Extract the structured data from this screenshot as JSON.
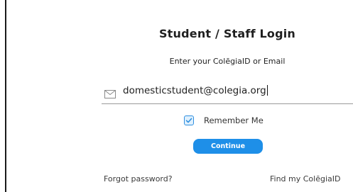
{
  "login": {
    "title": "Student / Staff Login",
    "subtitle": "Enter your ColēgiaID or Email",
    "email_value": "domesticstudent@colegia.org",
    "email_icon": "mail-icon",
    "remember_label": "Remember Me",
    "remember_checked": true,
    "continue_label": "Continue",
    "forgot_link": "Forgot password?",
    "find_id_link": "Find my ColēgiaID"
  },
  "colors": {
    "accent": "#1e8fe8",
    "checkbox_border": "#2f8fe0",
    "checkbox_fill": "#dff0fd"
  }
}
